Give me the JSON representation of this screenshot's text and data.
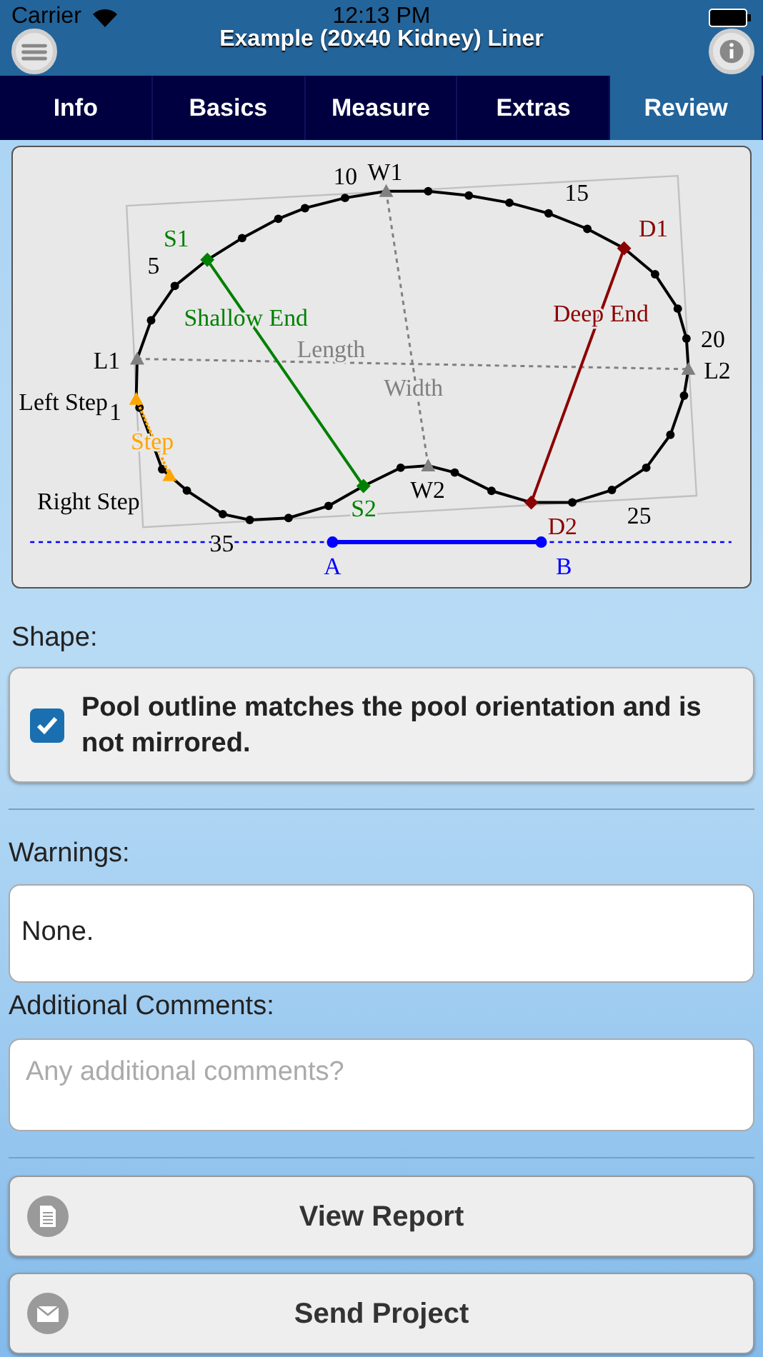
{
  "status_bar": {
    "carrier": "Carrier",
    "time": "12:13 PM"
  },
  "header": {
    "title": "Example (20x40 Kidney) Liner"
  },
  "tabs": [
    {
      "label": "Info",
      "selected": false
    },
    {
      "label": "Basics",
      "selected": false
    },
    {
      "label": "Measure",
      "selected": false
    },
    {
      "label": "Extras",
      "selected": false
    },
    {
      "label": "Review",
      "selected": true
    }
  ],
  "diagram": {
    "labels": [
      {
        "text": "10",
        "color": "#000000"
      },
      {
        "text": "W1",
        "color": "#000000"
      },
      {
        "text": "15",
        "color": "#000000"
      },
      {
        "text": "S1",
        "color": "#008000"
      },
      {
        "text": "D1",
        "color": "#8b0000"
      },
      {
        "text": "5",
        "color": "#000000"
      },
      {
        "text": "Shallow End",
        "color": "#008000"
      },
      {
        "text": "Deep End",
        "color": "#8b0000"
      },
      {
        "text": "20",
        "color": "#000000"
      },
      {
        "text": "L1",
        "color": "#000000"
      },
      {
        "text": "Length",
        "color": "#808080"
      },
      {
        "text": "L2",
        "color": "#000000"
      },
      {
        "text": "Left Step",
        "color": "#000000"
      },
      {
        "text": "1",
        "color": "#000000"
      },
      {
        "text": "Width",
        "color": "#808080"
      },
      {
        "text": "Step",
        "color": "#ffa500"
      },
      {
        "text": "Right Step",
        "color": "#000000"
      },
      {
        "text": "S2",
        "color": "#008000"
      },
      {
        "text": "W2",
        "color": "#000000"
      },
      {
        "text": "25",
        "color": "#000000"
      },
      {
        "text": "D2",
        "color": "#8b0000"
      },
      {
        "text": "35",
        "color": "#000000"
      },
      {
        "text": "A",
        "color": "#0000ff"
      },
      {
        "text": "B",
        "color": "#0000ff"
      }
    ]
  },
  "shape": {
    "label": "Shape:",
    "checkbox": {
      "label": "Pool outline matches the pool orientation and is not mirrored.",
      "checked": true
    }
  },
  "warnings": {
    "label": "Warnings:",
    "value": "None."
  },
  "comments": {
    "label": "Additional Comments:",
    "placeholder": "Any additional comments?"
  },
  "buttons": [
    {
      "label": "View Report",
      "kind": "report"
    },
    {
      "label": "Send Project",
      "kind": "send"
    }
  ]
}
